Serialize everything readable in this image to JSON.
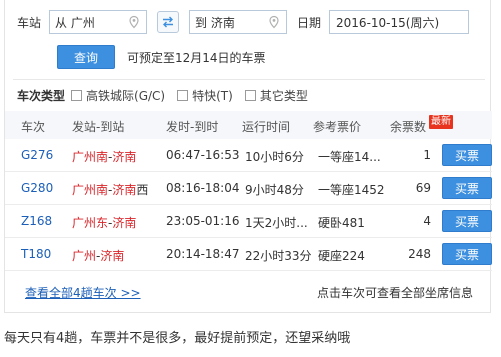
{
  "search": {
    "from_label": "车站",
    "from_value": "从 广州",
    "to_value": "到 济南",
    "date_label": "日期",
    "date_value": "2016-10-15(周六)"
  },
  "query": {
    "button": "查询",
    "presale_text": "可预定至12月14日的车票"
  },
  "filters": {
    "title": "车次类型",
    "options": [
      "高铁城际(G/C)",
      "特快(T)",
      "其它类型"
    ]
  },
  "table": {
    "headers": [
      "车次",
      "发站-到站",
      "发时-到时",
      "运行时间",
      "参考票价",
      "余票数"
    ],
    "new_badge": "最新",
    "buy_label": "买票",
    "rows": [
      {
        "train": "G276",
        "from_station": "广州南",
        "dash": "-",
        "to_station": "济南",
        "to_suffix": "",
        "times": "06:47-16:53",
        "duration": "10小时6分",
        "price": "一等座14...",
        "seats": "1"
      },
      {
        "train": "G280",
        "from_station": "广州南",
        "dash": "-",
        "to_station": "济南",
        "to_suffix": "西",
        "times": "08:16-18:04",
        "duration": "9小时48分",
        "price": "一等座1452",
        "seats": "69"
      },
      {
        "train": "Z168",
        "from_station": "广州东",
        "dash": "-",
        "to_station": "济南",
        "to_suffix": "",
        "times": "23:05-01:16",
        "duration": "1天2小时...",
        "price": "硬卧481",
        "seats": "4"
      },
      {
        "train": "T180",
        "from_station": "广州",
        "dash": "-",
        "to_station": "济南",
        "to_suffix": "",
        "times": "20:14-18:47",
        "duration": "22小时33分",
        "price": "硬座224",
        "seats": "248"
      }
    ]
  },
  "footer": {
    "more_link": "查看全部4趟车次 >>",
    "hint": "点击车次可查看全部坐席信息"
  },
  "comment": "每天只有4趟，车票并不是很多，最好提前预定，还望采纳哦",
  "colors": {
    "accent": "#3d8fe0",
    "link": "#1c5fb8",
    "red": "#d9252a",
    "badge": "#e8331e"
  },
  "icons": [
    "location-pin-icon",
    "swap-icon",
    "checkbox-icon"
  ]
}
